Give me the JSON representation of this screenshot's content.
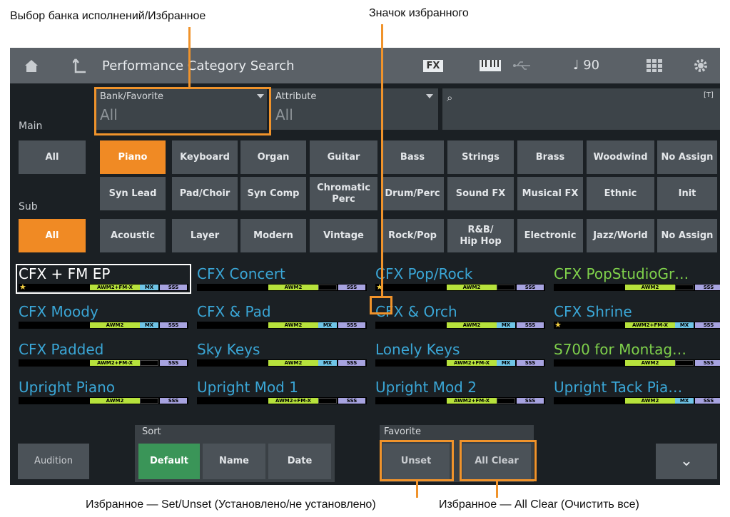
{
  "callouts": {
    "bank_favorite": "Выбор банка исполнений/Избранное",
    "favorite_icon": "Значок избранного",
    "favorite_set_unset": "Избранное — Set/Unset (Установлено/не установлено)",
    "favorite_all_clear": "Избранное — All Clear (Очистить все)"
  },
  "header": {
    "title": "Performance Category Search",
    "fx_label": "FX",
    "tempo": "♩ 90"
  },
  "filters": {
    "bank_label": "Bank/Favorite",
    "bank_value": "All",
    "attribute_label": "Attribute",
    "attribute_value": "All",
    "search_icon": "⌕",
    "text_tag": "[T]",
    "main_label": "Main",
    "sub_label": "Sub"
  },
  "main_buttons": [
    "All",
    "Piano",
    "Keyboard",
    "Organ",
    "Guitar",
    "Bass",
    "Strings",
    "Brass",
    "Woodwind",
    "No Assign"
  ],
  "main_buttons_row2": [
    "Syn Lead",
    "Pad/Choir",
    "Syn Comp",
    "Chromatic\nPerc",
    "Drum/Perc",
    "Sound FX",
    "Musical FX",
    "Ethnic",
    "Init"
  ],
  "sub_buttons": [
    "All",
    "Acoustic",
    "Layer",
    "Modern",
    "Vintage",
    "Rock/Pop",
    "R&B/\nHip Hop",
    "Electronic",
    "Jazz/World",
    "No Assign"
  ],
  "performances": [
    {
      "name": "CFX + FM EP",
      "tags": "awm+fm,mx,sss",
      "star": true,
      "selected": true
    },
    {
      "name": "CFX Concert",
      "tags": "awm,sss"
    },
    {
      "name": "CFX Pop/Rock",
      "tags": "awm,sss",
      "star": true
    },
    {
      "name": "CFX PopStudioGr…",
      "tags": "awm,sss",
      "green": true
    },
    {
      "name": "CFX Moody",
      "tags": "awm,mx,sss"
    },
    {
      "name": "CFX & Pad",
      "tags": "awm,mx,sss"
    },
    {
      "name": "CFX & Orch",
      "tags": "awm,mx,sss"
    },
    {
      "name": "CFX Shrine",
      "tags": "awm+fm,mx,sss",
      "star": true
    },
    {
      "name": "CFX Padded",
      "tags": "awm+fm,sss"
    },
    {
      "name": "Sky Keys",
      "tags": "awm,mx,sss"
    },
    {
      "name": "Lonely Keys",
      "tags": "awm+fm,mx,sss"
    },
    {
      "name": "S700 for Montag…",
      "tags": "awm,sss",
      "green": true
    },
    {
      "name": "Upright Piano",
      "tags": "awm,sss"
    },
    {
      "name": "Upright Mod 1",
      "tags": "awm+fm,sss"
    },
    {
      "name": "Upright Mod 2",
      "tags": "awm+fm,sss"
    },
    {
      "name": "Upright Tack Pia…",
      "tags": "awm,mx,sss"
    }
  ],
  "tag_labels": {
    "awm": "AWM2",
    "awm_fm": "AWM2+FM-X",
    "mx": "MX",
    "sss": "SSS"
  },
  "bottom": {
    "audition": "Audition",
    "sort_label": "Sort",
    "sort_default": "Default",
    "sort_name": "Name",
    "sort_date": "Date",
    "favorite_label": "Favorite",
    "unset": "Unset",
    "all_clear": "All Clear",
    "more": "⌄"
  },
  "colors": {
    "accent_orange": "#f08a24",
    "sort_active_green": "#3a9558",
    "name_blue": "#3aa6d6",
    "name_green": "#7fd14b"
  }
}
